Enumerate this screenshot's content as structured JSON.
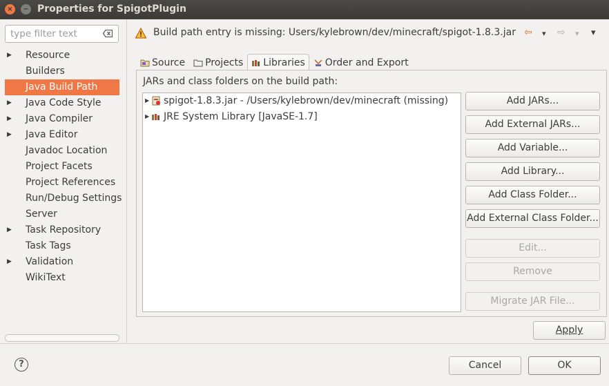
{
  "window": {
    "title": "Properties for SpigotPlugin",
    "close_glyph": "×",
    "minimize_glyph": "−"
  },
  "filter": {
    "placeholder": "type filter text"
  },
  "tree": {
    "items": [
      {
        "label": "Resource",
        "expandable": true
      },
      {
        "label": "Builders",
        "expandable": false
      },
      {
        "label": "Java Build Path",
        "expandable": false,
        "selected": true
      },
      {
        "label": "Java Code Style",
        "expandable": true
      },
      {
        "label": "Java Compiler",
        "expandable": true
      },
      {
        "label": "Java Editor",
        "expandable": true
      },
      {
        "label": "Javadoc Location",
        "expandable": false
      },
      {
        "label": "Project Facets",
        "expandable": false
      },
      {
        "label": "Project References",
        "expandable": false
      },
      {
        "label": "Run/Debug Settings",
        "expandable": false
      },
      {
        "label": "Server",
        "expandable": false
      },
      {
        "label": "Task Repository",
        "expandable": true
      },
      {
        "label": "Task Tags",
        "expandable": false
      },
      {
        "label": "Validation",
        "expandable": true
      },
      {
        "label": "WikiText",
        "expandable": false
      }
    ]
  },
  "header": {
    "message": "Build path entry is missing: Users/kylebrown/dev/minecraft/spigot-1.8.3.jar",
    "back_glyph": "⇦",
    "forward_glyph": "⇨",
    "dropdown_glyph": "▾",
    "menu_glyph": "▾"
  },
  "tabs": [
    {
      "label": "Source",
      "active": false
    },
    {
      "label": "Projects",
      "active": false
    },
    {
      "label": "Libraries",
      "active": true
    },
    {
      "label": "Order and Export",
      "active": false
    }
  ],
  "libraries": {
    "caption": "JARs and class folders on the build path:",
    "entries": [
      {
        "label": "spigot-1.8.3.jar - /Users/kylebrown/dev/minecraft (missing)",
        "icon": "jar-missing-icon"
      },
      {
        "label": "JRE System Library [JavaSE-1.7]",
        "icon": "library-icon"
      }
    ],
    "expand_glyph": "▶"
  },
  "buttons": {
    "add_jars": "Add JARs...",
    "add_external_jars": "Add External JARs...",
    "add_variable": "Add Variable...",
    "add_library": "Add Library...",
    "add_class_folder": "Add Class Folder...",
    "add_external_class_folder": "Add External Class Folder...",
    "edit": "Edit...",
    "remove": "Remove",
    "migrate_jar": "Migrate JAR File...",
    "apply": "Apply",
    "cancel": "Cancel",
    "ok": "OK",
    "help": "?"
  },
  "colors": {
    "accent": "#f07746",
    "titlebar": "#3c3b37"
  }
}
